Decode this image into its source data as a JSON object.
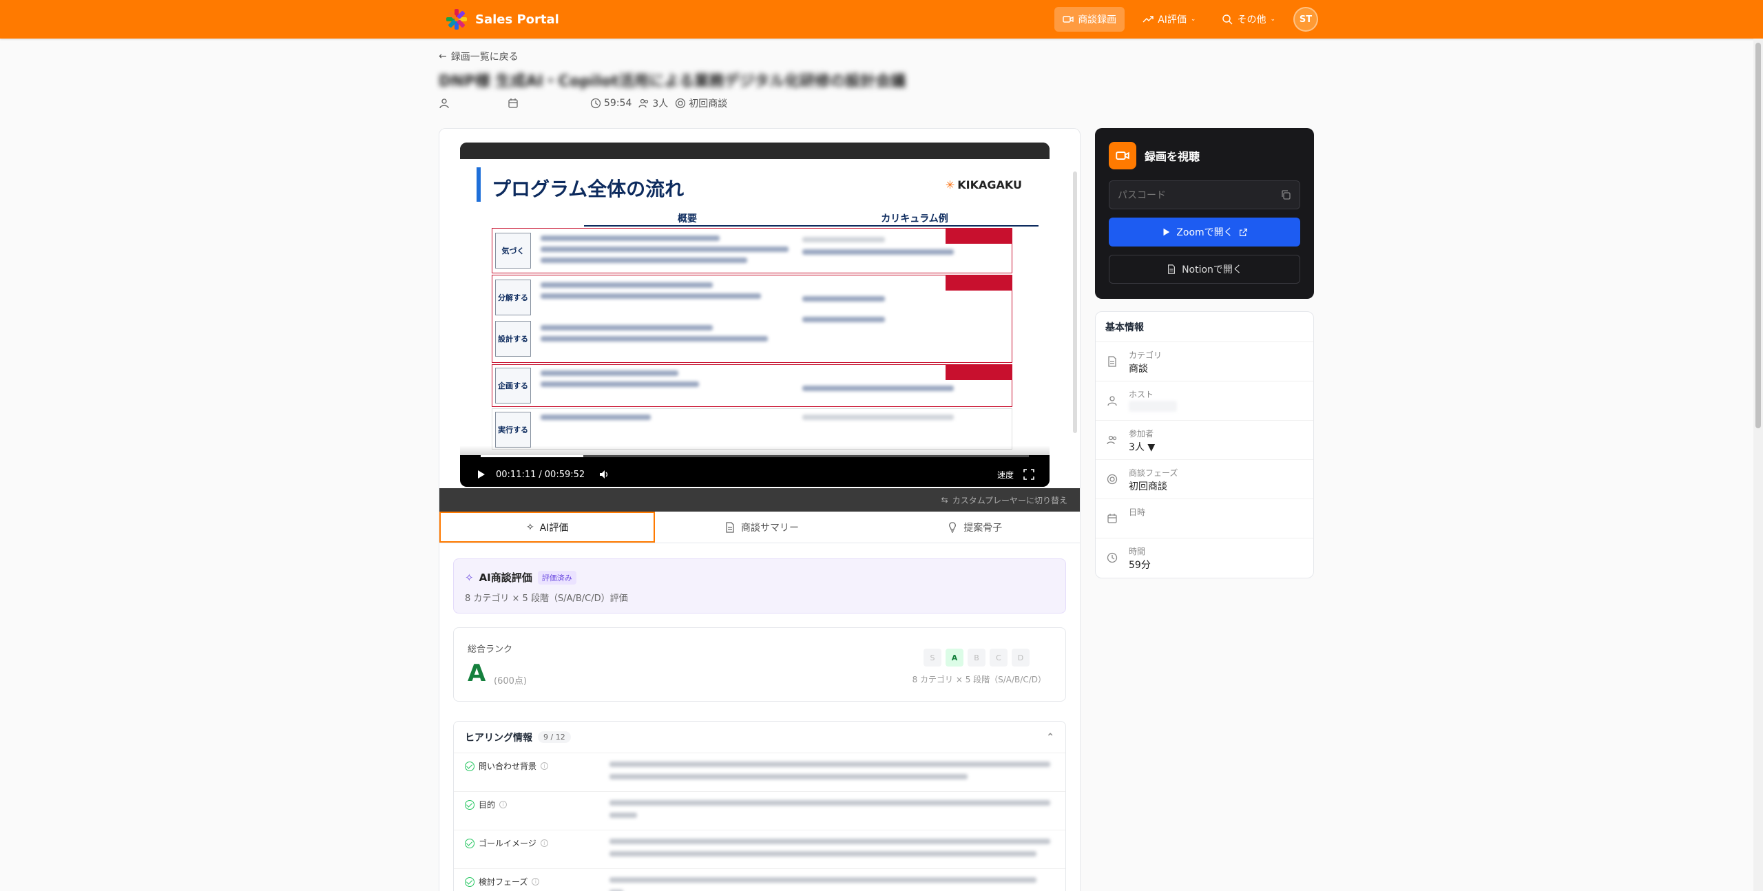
{
  "header": {
    "app_name": "Sales Portal",
    "nav": [
      {
        "label": "商談録画",
        "icon": "video-icon",
        "active": true
      },
      {
        "label": "AI評価",
        "icon": "trend-icon",
        "active": false
      },
      {
        "label": "その他",
        "icon": "search-icon",
        "active": false
      }
    ],
    "user_initials": "ST"
  },
  "page": {
    "back_label": "録画一覧に戻る",
    "title": "DNP様 生成AI・Copilot活用による業務デジタル化研修の設計会議",
    "duration": "59:54",
    "participants": "3人",
    "phase": "初回商談"
  },
  "player": {
    "slide_title": "プログラム全体の流れ",
    "slide_brand": "KIKAGAKU",
    "col_overview": "概要",
    "col_curriculum": "カリキュラム例",
    "stages": [
      "気づく",
      "分解する",
      "設計する",
      "企画する",
      "実行する"
    ],
    "current_time": "00:11:11",
    "total_time": "00:59:52",
    "progress": 0.187,
    "speed_label": "速度",
    "switch_label": "カスタムプレーヤーに切り替え"
  },
  "tabs": [
    {
      "label": "AI評価",
      "icon": "sparkle-icon",
      "active": true
    },
    {
      "label": "商談サマリー",
      "icon": "document-icon",
      "active": false
    },
    {
      "label": "提案骨子",
      "icon": "bulb-icon",
      "active": false
    }
  ],
  "evaluation": {
    "title": "AI商談評価",
    "badge": "評価済み",
    "subtitle": "8 カテゴリ × 5 段階（S/A/B/C/D）評価"
  },
  "rank": {
    "label": "総合ランク",
    "value": "A",
    "score": "(600点)",
    "grades": [
      "S",
      "A",
      "B",
      "C",
      "D"
    ],
    "active_grade": "A",
    "note": "8 カテゴリ × 5 段階（S/A/B/C/D）"
  },
  "hearing": {
    "title": "ヒアリング情報",
    "count": "9 / 12",
    "items": [
      "問い合わせ背景",
      "目的",
      "ゴールイメージ",
      "検討フェーズ"
    ]
  },
  "watch": {
    "title": "録画を視聴",
    "passcode_placeholder": "パスコード",
    "zoom_label": "Zoomで開く",
    "notion_label": "Notionで開く"
  },
  "info": {
    "title": "基本情報",
    "rows": [
      {
        "label": "カテゴリ",
        "value": "商談",
        "icon": "document-icon"
      },
      {
        "label": "ホスト",
        "value": "",
        "icon": "user-icon"
      },
      {
        "label": "参加者",
        "value": "3人 ▼",
        "icon": "users-icon"
      },
      {
        "label": "商談フェーズ",
        "value": "初回商談",
        "icon": "target-icon"
      },
      {
        "label": "日時",
        "value": "",
        "icon": "calendar-icon"
      },
      {
        "label": "時間",
        "value": "59分",
        "icon": "clock-icon"
      }
    ]
  },
  "colors": {
    "brand": "#ff7a00",
    "zoom": "#1d5cf2",
    "rank_green": "#15803d"
  }
}
